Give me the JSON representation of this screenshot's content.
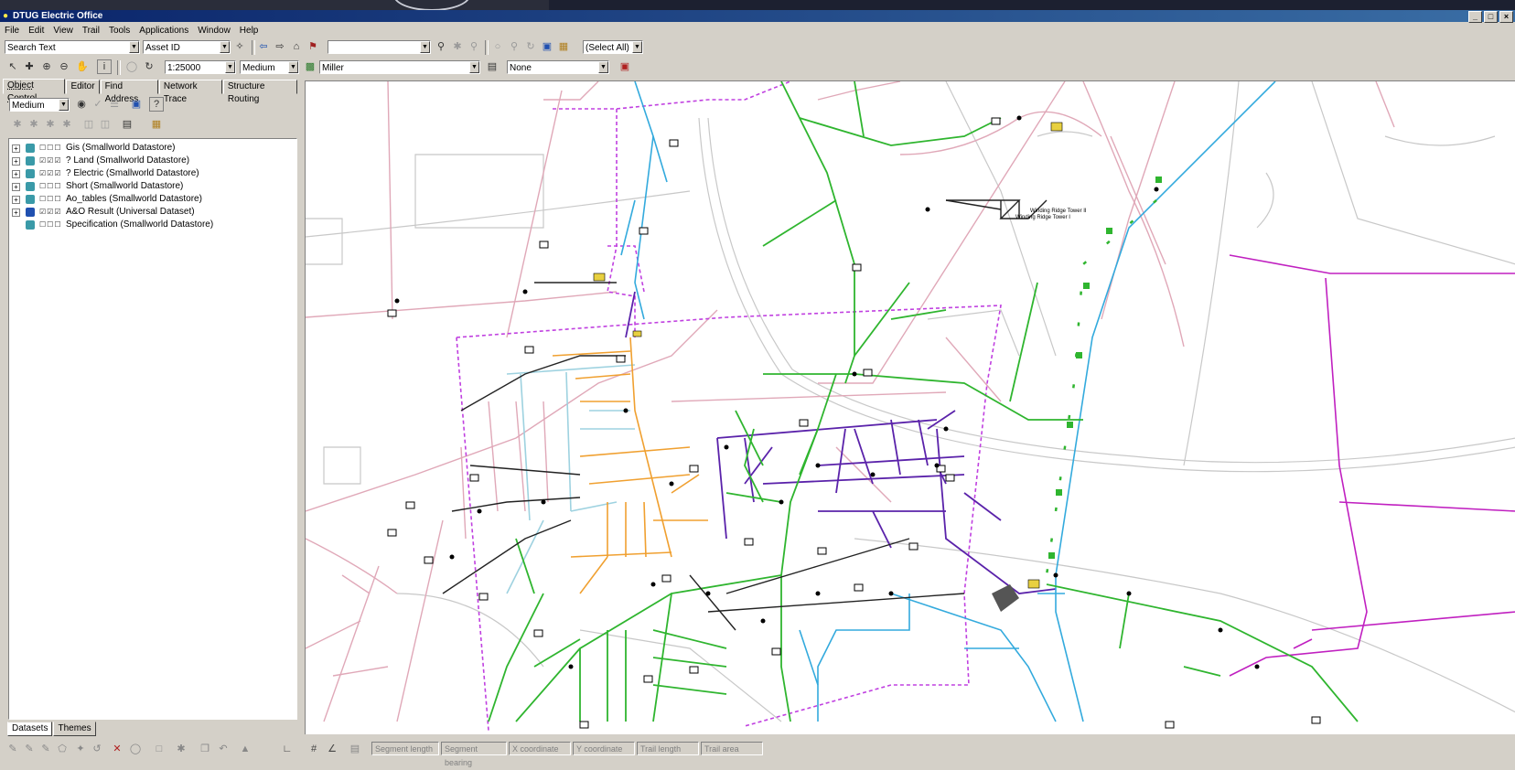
{
  "window": {
    "title": "DTUG Electric Office"
  },
  "menu": [
    "File",
    "Edit",
    "View",
    "Trail",
    "Tools",
    "Applications",
    "Window",
    "Help"
  ],
  "toolbar1": {
    "search_mode": "Search Text",
    "search_field": "Asset ID",
    "search_value": "",
    "select_all": "(Select All)"
  },
  "toolbar2": {
    "scale": "1:25000",
    "detail": "Medium",
    "user": "Miller",
    "overlay": "None"
  },
  "panel": {
    "tabs": [
      "Object Control",
      "Editor",
      "Find Address",
      "Network Trace",
      "Structure Routing"
    ],
    "detail_level": "Medium",
    "datasets": [
      {
        "label": "Gis (Smallworld Datastore)",
        "checks": "☐☐☐",
        "expandable": true
      },
      {
        "label": "? Land (Smallworld Datastore)",
        "checks": "☑☑☑",
        "expandable": true
      },
      {
        "label": "? Electric (Smallworld Datastore)",
        "checks": "☑☑☑",
        "expandable": true
      },
      {
        "label": "Short (Smallworld Datastore)",
        "checks": "☐☐☐",
        "expandable": true
      },
      {
        "label": "Ao_tables (Smallworld Datastore)",
        "checks": "☐☐☐",
        "expandable": true
      },
      {
        "label": "A&O Result (Universal Dataset)",
        "checks": "☑☑☑",
        "expandable": true
      },
      {
        "label": "Specification (Smallworld Datastore)",
        "checks": "☐☐☐",
        "expandable": false
      }
    ],
    "bottom_tabs": [
      "Datasets",
      "Themes"
    ]
  },
  "map": {
    "labels": [
      "Winding Ridge Tower II",
      "Winding Ridge Tower I"
    ],
    "colors": {
      "road": "#c8c8c8",
      "parcel": "#e0a8b8",
      "feeder_green": "#2fb52f",
      "feeder_blue": "#33aadd",
      "feeder_purple": "#5a22aa",
      "feeder_orange": "#f0a030",
      "feeder_lightblue": "#9ed2e0",
      "boundary": "#c040e0",
      "magenta": "#c020c0"
    }
  },
  "status": [
    "Segment length",
    "Segment bearing",
    "X coordinate",
    "Y coordinate",
    "Trail length",
    "Trail area"
  ]
}
